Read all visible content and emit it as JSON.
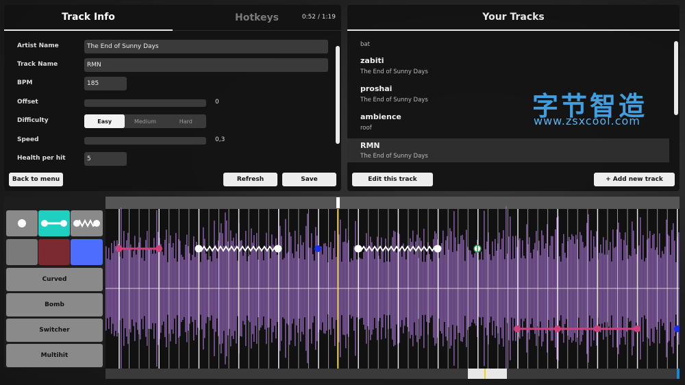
{
  "info": {
    "tab_active": "Track Info",
    "tab_inactive": "Hotkeys",
    "time": "0:52 / 1:19",
    "fields": {
      "artist_label": "Artist Name",
      "artist_value": "The End of Sunny Days",
      "track_label": "Track Name",
      "track_value": "RMN",
      "bpm_label": "BPM",
      "bpm_value": "185",
      "offset_label": "Offset",
      "offset_value": "0",
      "offset_level": 0,
      "difficulty_label": "Difficulty",
      "difficulty_options": [
        "Easy",
        "Medium",
        "Hard"
      ],
      "difficulty_selected": "Easy",
      "speed_label": "Speed",
      "speed_value": "0,3",
      "speed_level": 0,
      "health_label": "Health per hit",
      "health_value": "5"
    },
    "buttons": {
      "back": "Back to menu",
      "refresh": "Refresh",
      "save": "Save"
    }
  },
  "tracks": {
    "title": "Your Tracks",
    "items": [
      {
        "name": "",
        "artist": "bat"
      },
      {
        "name": "zabiti",
        "artist": "The End of Sunny Days"
      },
      {
        "name": "proshai",
        "artist": "The End of Sunny Days"
      },
      {
        "name": "ambience",
        "artist": "roof"
      },
      {
        "name": "RMN",
        "artist": "The End of Sunny Days",
        "selected": true
      }
    ],
    "buttons": {
      "edit": "Edit this track",
      "add": "+ Add new track"
    },
    "watermark_cn": "字节智造",
    "watermark_url": "www.zsxcool.com"
  },
  "tools": {
    "shapes": [
      "tap-note-icon",
      "hold-note-icon",
      "zigzag-note-icon"
    ],
    "colors": [
      "#7a7a7a",
      "#7a2a30",
      "#4d6dff"
    ],
    "buttons": [
      "Curved",
      "Bomb",
      "Switcher",
      "Multihit"
    ]
  },
  "timeline": {
    "accent": "#1fd0c0",
    "playhead_color": "#f0d020",
    "waveform_color": "#9a6bc4"
  }
}
